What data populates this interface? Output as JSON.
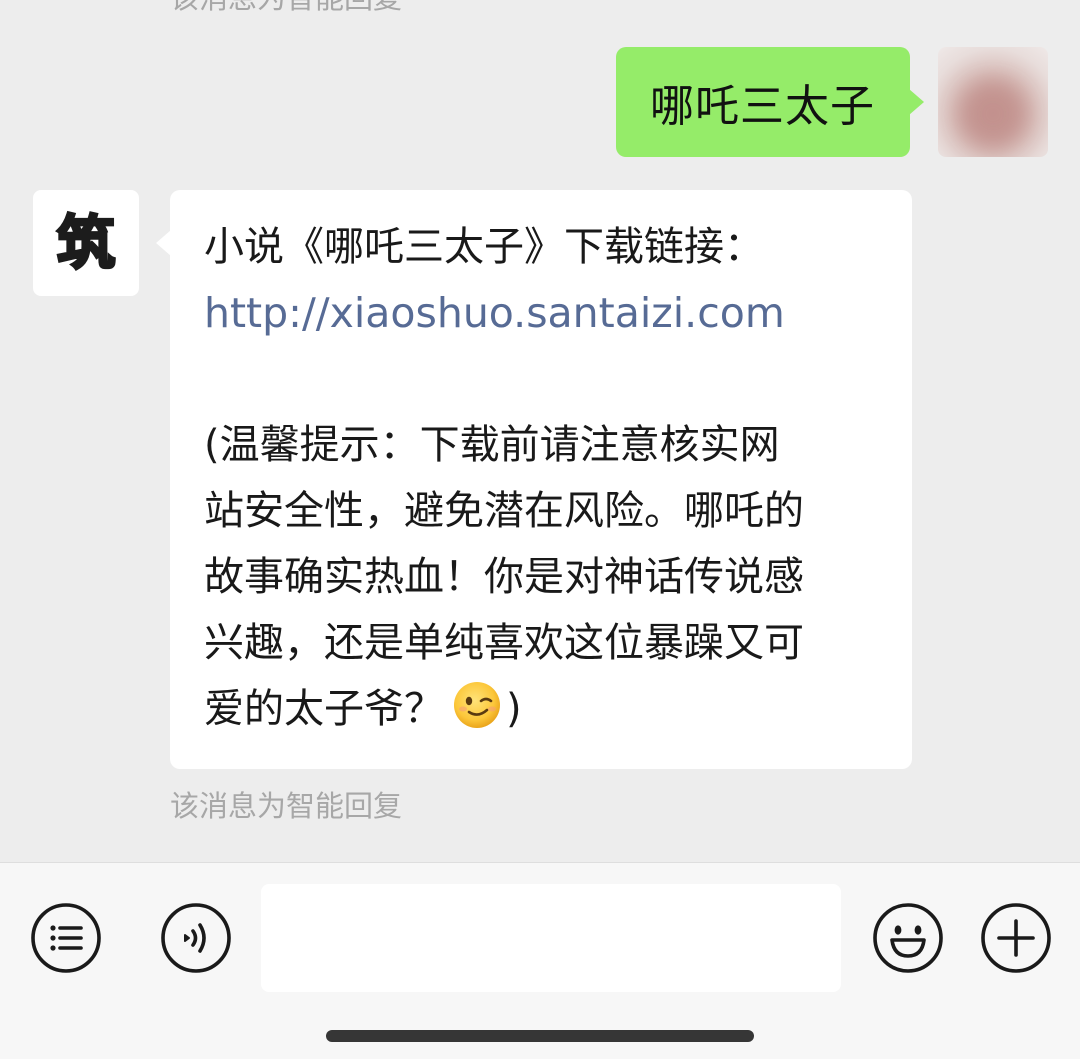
{
  "chat": {
    "top_note": "该消息为智能回复",
    "user_message": "哪吒三太子",
    "bot_avatar_text": "筑",
    "reply": {
      "line1": "小说《哪吒三太子》下载链接：",
      "link": "http://xiaoshuo.santaizi.com",
      "tip_lines": [
        "(温馨提示：下载前请注意核实网",
        "站安全性，避免潜在风险。哪吒的",
        "故事确实热血！你是对神话传说感",
        "兴趣，还是单纯喜欢这位暴躁又可",
        "爱的太子爷？"
      ],
      "tip_end": ")",
      "emoji": "wink-emoji"
    },
    "bottom_note": "该消息为智能回复"
  },
  "input_bar": {
    "input_value": "",
    "icons": {
      "menu": "list-circle-icon",
      "voice": "voice-icon",
      "emoji": "smiley-icon",
      "add": "plus-icon"
    }
  },
  "colors": {
    "background": "#ededed",
    "user_bubble": "#95ec69",
    "bot_bubble": "#ffffff",
    "link": "#576b95",
    "note": "#a7a7a7",
    "input_bar": "#f7f7f7"
  }
}
